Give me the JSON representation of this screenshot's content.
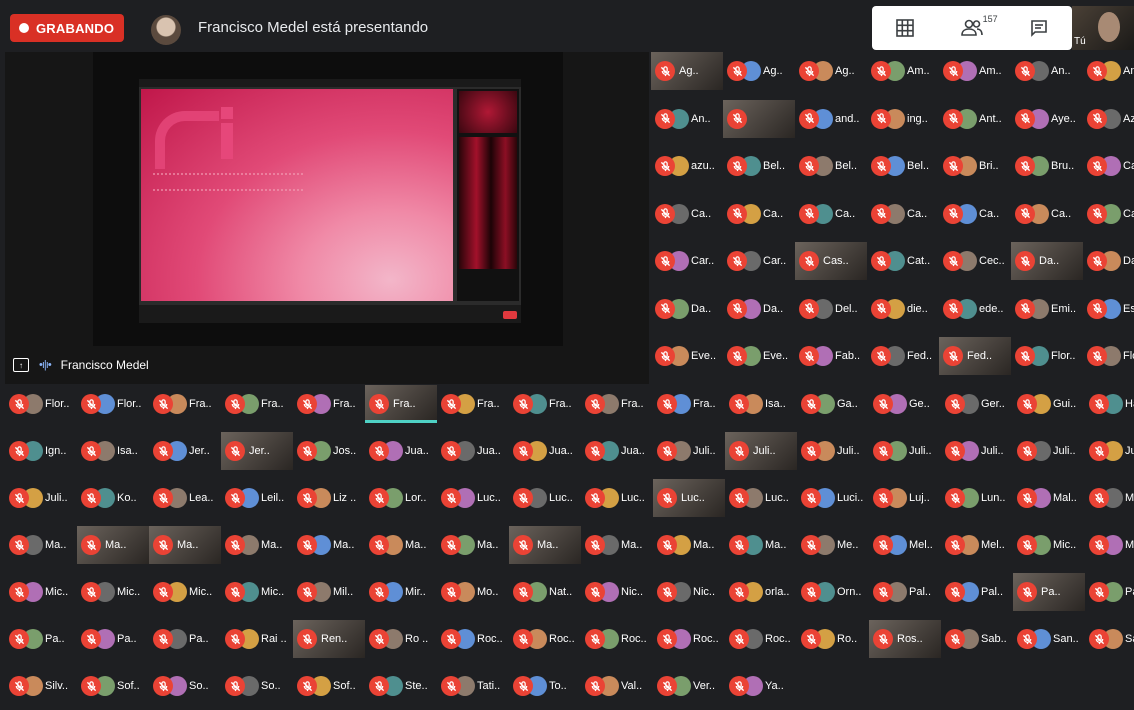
{
  "recording": {
    "label": "GRABANDO"
  },
  "presenting": {
    "text": "Francisco Medel está presentando"
  },
  "controls": {
    "participants_count": "157"
  },
  "self": {
    "label": "Tú"
  },
  "stage": {
    "presenter_name": "Francisco Medel"
  },
  "colors": {
    "record": "#d93025",
    "mic_off": "#ea4335",
    "background": "#1e1f22",
    "active_speaker": "#4fd1c5"
  },
  "right_grid": [
    [
      "Ag..",
      "Ag..",
      "Ag..",
      "Am..",
      "Am..",
      "An..",
      "An"
    ],
    [
      "An..",
      "",
      "and..",
      "ing..",
      "Ant..",
      "Aye..",
      "Az"
    ],
    [
      "azu..",
      "Bel..",
      "Bel..",
      "Bel..",
      "Bri..",
      "Bru..",
      "Ca"
    ],
    [
      "Ca..",
      "Ca..",
      "Ca..",
      "Ca..",
      "Ca..",
      "Ca..",
      "Ca"
    ],
    [
      "Car..",
      "Car..",
      "Cas..",
      "Cat..",
      "Cec..",
      "Da..",
      "Da"
    ],
    [
      "Da..",
      "Da..",
      "Del..",
      "die..",
      "ede..",
      "Emi..",
      "Est"
    ],
    [
      "Eve..",
      "Eve..",
      "Fab..",
      "Fed..",
      "Fed..",
      "Flor..",
      "Flo"
    ]
  ],
  "bottom_grid": [
    [
      "Flor..",
      "Flor..",
      "Fra..",
      "Fra..",
      "Fra..",
      "Fra..",
      "Fra..",
      "Fra..",
      "Fra..",
      "Fra..",
      "Isa..",
      "Ga..",
      "Ge..",
      "Ger..",
      "Gui..",
      "Ha"
    ],
    [
      "Ign..",
      "Isa..",
      "Jer..",
      "Jer..",
      "Jos..",
      "Jua..",
      "Jua..",
      "Jua..",
      "Jua..",
      "Juli..",
      "Juli..",
      "Juli..",
      "Juli..",
      "Juli..",
      "Juli..",
      "Jul"
    ],
    [
      "Juli..",
      "Ko..",
      "Lea..",
      "Leil..",
      "Liz ..",
      "Lor..",
      "Luc..",
      "Luc..",
      "Luc..",
      "Luc..",
      "Luc..",
      "Luci..",
      "Luj..",
      "Lun..",
      "Mal..",
      "Ma"
    ],
    [
      "Ma..",
      "Ma..",
      "Ma..",
      "Ma..",
      "Ma..",
      "Ma..",
      "Ma..",
      "Ma..",
      "Ma..",
      "Ma..",
      "Ma..",
      "Me..",
      "Mel..",
      "Mel..",
      "Mic..",
      "Mi"
    ],
    [
      "Mic..",
      "Mic..",
      "Mic..",
      "Mic..",
      "Mil..",
      "Mir..",
      "Mo..",
      "Nat..",
      "Nic..",
      "Nic..",
      "orla..",
      "Orn..",
      "Pal..",
      "Pal..",
      "Pa..",
      "Pa"
    ],
    [
      "Pa..",
      "Pa..",
      "Pa..",
      "Rai ..",
      "Ren..",
      "Ro ..",
      "Roc..",
      "Roc..",
      "Roc..",
      "Roc..",
      "Roc..",
      "Ro..",
      "Ros..",
      "Sab..",
      "San..",
      "Sa"
    ],
    [
      "Silv..",
      "Sof..",
      "So..",
      "So..",
      "Sof..",
      "Ste..",
      "Tati..",
      "To..",
      "Val..",
      "Ver..",
      "Ya.."
    ]
  ],
  "right_video": [
    [
      0,
      0
    ],
    [
      1,
      1
    ],
    [
      4,
      2
    ],
    [
      4,
      5
    ],
    [
      6,
      4
    ]
  ],
  "bottom_video": [
    [
      0,
      5
    ],
    [
      1,
      3
    ],
    [
      1,
      10
    ],
    [
      2,
      9
    ],
    [
      3,
      1
    ],
    [
      3,
      2
    ],
    [
      3,
      7
    ],
    [
      4,
      14
    ],
    [
      5,
      4
    ],
    [
      5,
      12
    ]
  ]
}
